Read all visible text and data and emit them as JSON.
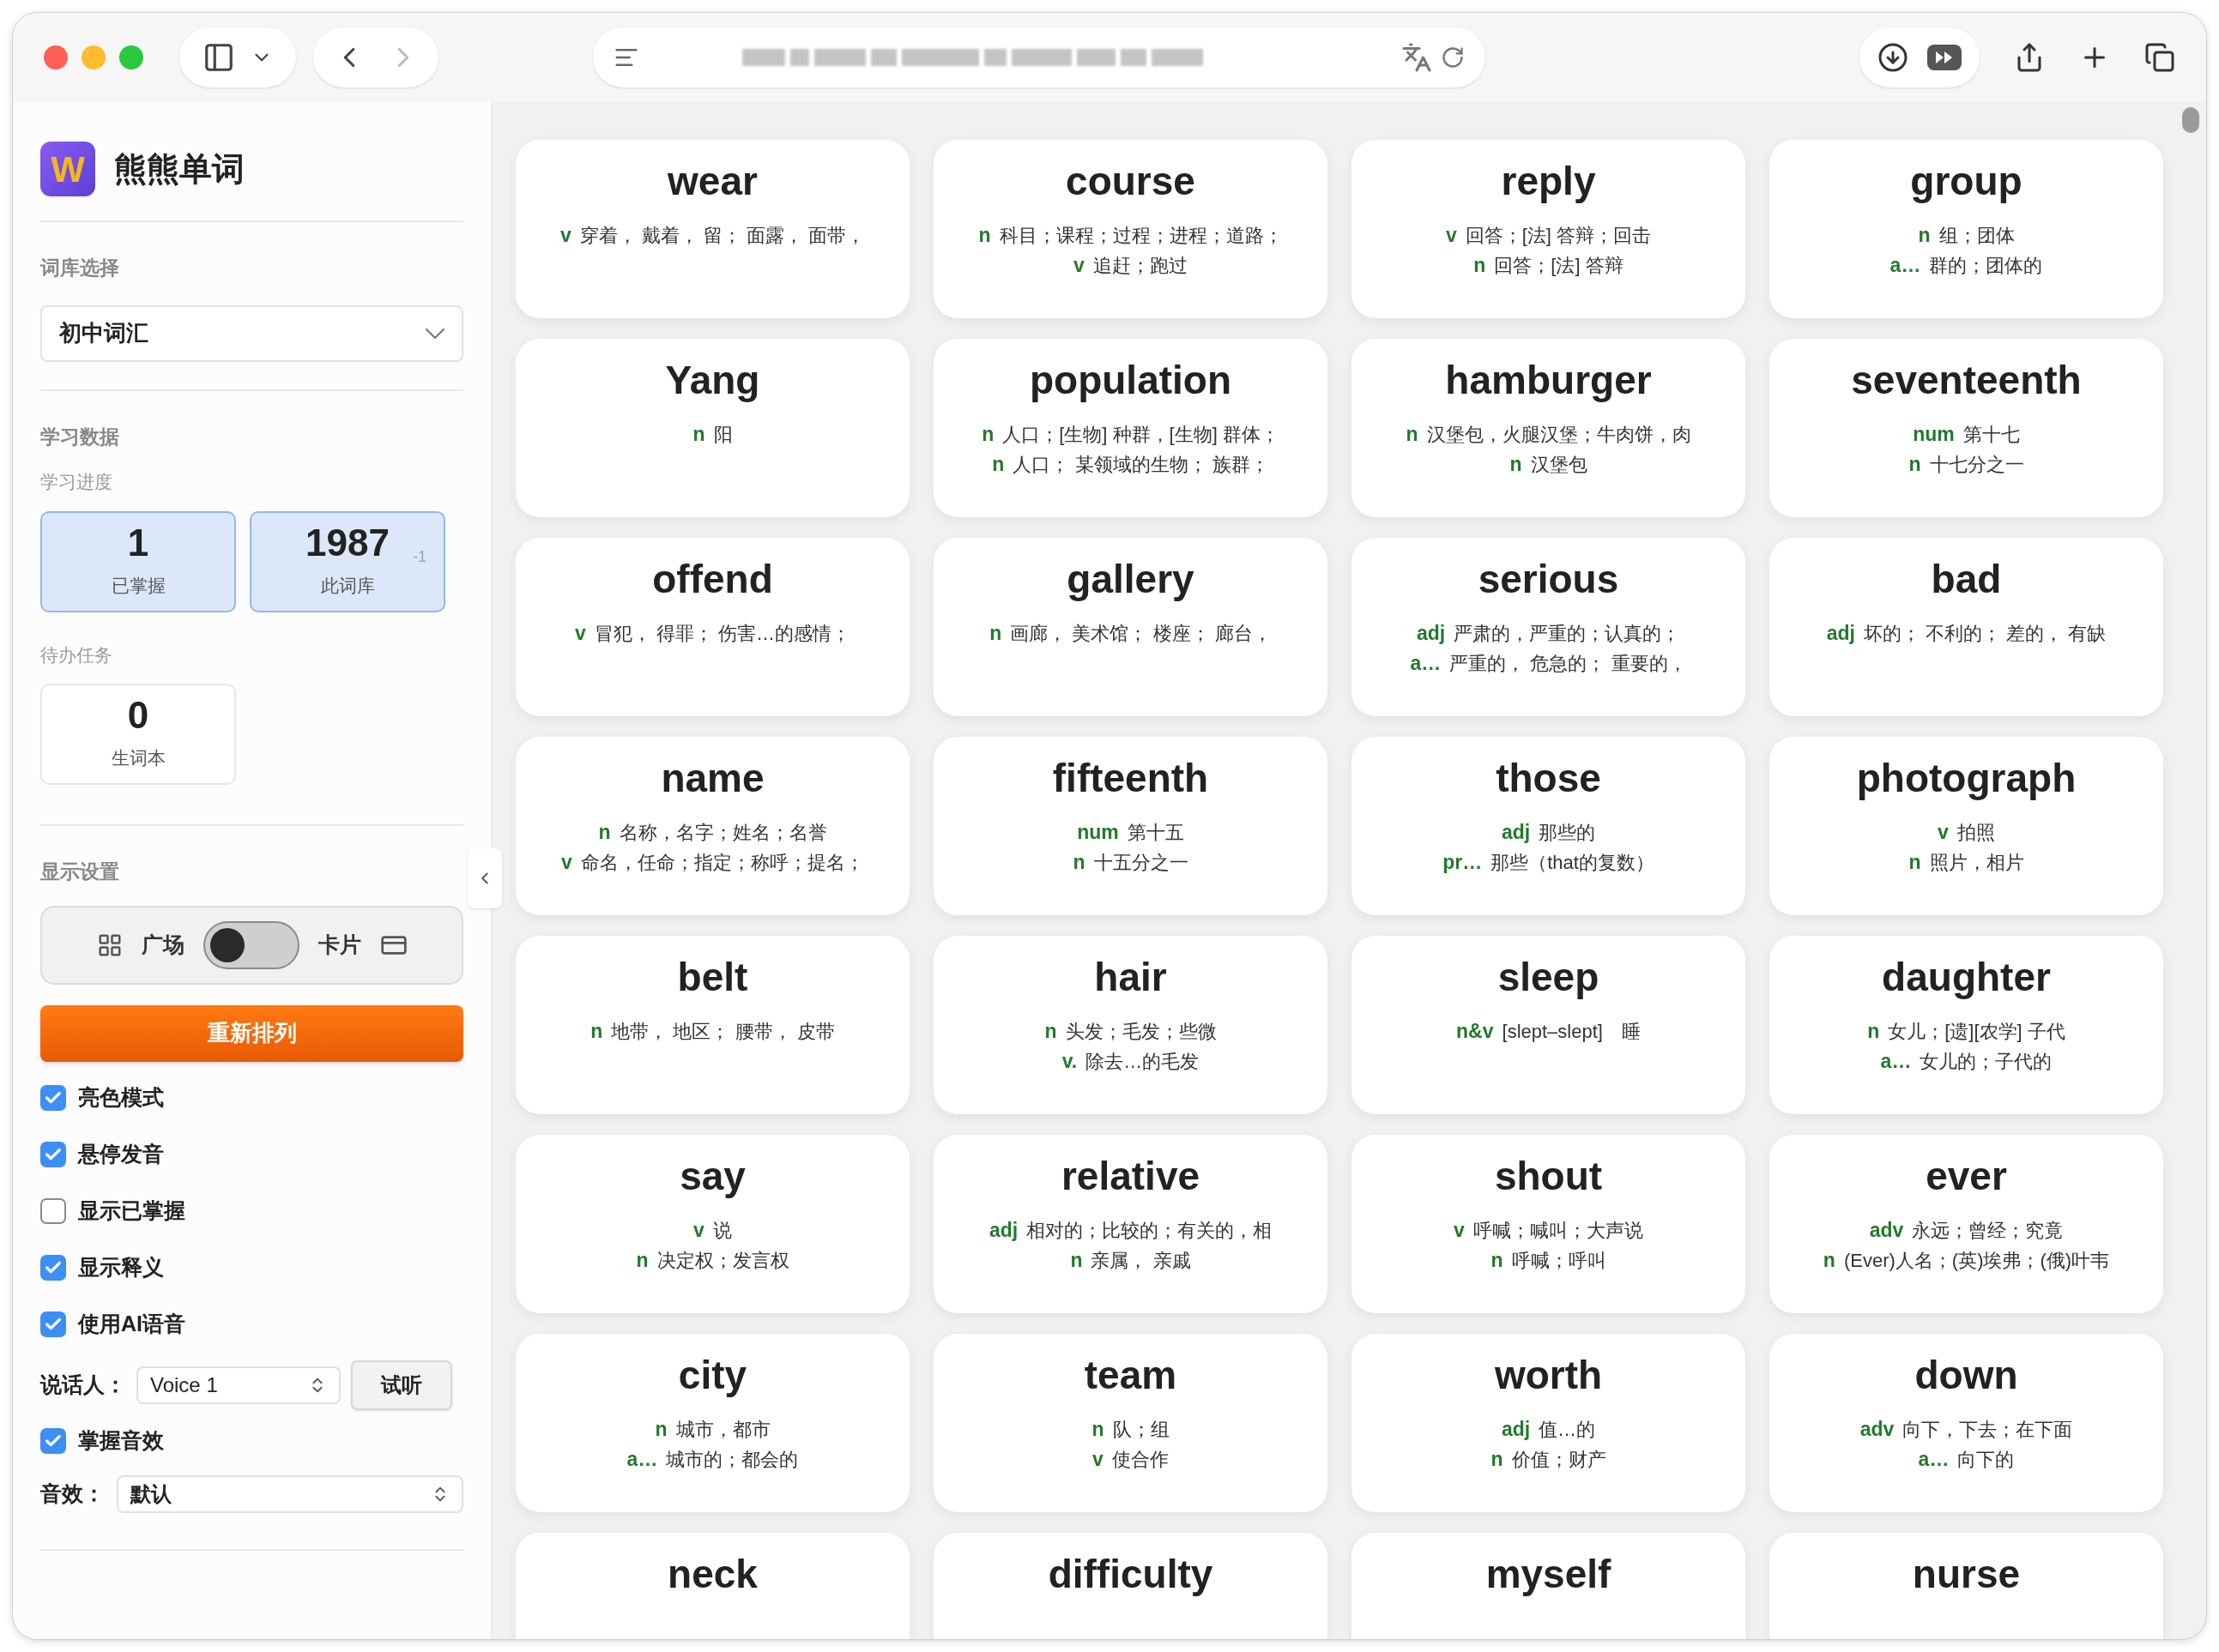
{
  "app": {
    "logo_letter": "W",
    "title": "熊熊单词"
  },
  "sidebar": {
    "library_label": "词库选择",
    "library_select": {
      "value": "初中词汇"
    },
    "stats_label": "学习数据",
    "progress_label": "学习进度",
    "progress": [
      {
        "value": "1",
        "label": "已掌握"
      },
      {
        "value": "1987",
        "label": "此词库",
        "delta": "-1"
      }
    ],
    "todo_label": "待办任务",
    "todo": [
      {
        "value": "0",
        "label": "生词本"
      }
    ],
    "display_label": "显示设置",
    "view_toggle": {
      "left": "广场",
      "right": "卡片",
      "on": false
    },
    "shuffle_button": "重新排列",
    "options": [
      {
        "label": "亮色模式",
        "checked": true
      },
      {
        "label": "悬停发音",
        "checked": true
      },
      {
        "label": "显示已掌握",
        "checked": false
      },
      {
        "label": "显示释义",
        "checked": true
      },
      {
        "label": "使用AI语音",
        "checked": true
      }
    ],
    "speaker": {
      "label": "说话人：",
      "value": "Voice 1",
      "button": "试听"
    },
    "sound_option": {
      "label": "掌握音效",
      "checked": true
    },
    "sound": {
      "label": "音效：",
      "value": "默认"
    }
  },
  "cards": [
    {
      "word": "wear",
      "senses": [
        {
          "pos": "v",
          "text": "穿着， 戴着， 留； 面露， 面带，"
        }
      ]
    },
    {
      "word": "course",
      "senses": [
        {
          "pos": "n",
          "text": "科目；课程；过程；进程；道路；"
        },
        {
          "pos": "v",
          "text": "追赶；跑过"
        }
      ]
    },
    {
      "word": "reply",
      "senses": [
        {
          "pos": "v",
          "text": "回答；[法] 答辩；回击"
        },
        {
          "pos": "n",
          "text": "回答；[法] 答辩"
        }
      ]
    },
    {
      "word": "group",
      "senses": [
        {
          "pos": "n",
          "text": "组；团体"
        },
        {
          "pos": "a…",
          "text": "群的；团体的"
        }
      ]
    },
    {
      "word": "Yang",
      "senses": [
        {
          "pos": "n",
          "text": "阳"
        }
      ]
    },
    {
      "word": "population",
      "senses": [
        {
          "pos": "n",
          "text": "人口；[生物] 种群，[生物] 群体；"
        },
        {
          "pos": "n",
          "text": "人口； 某领域的生物； 族群；"
        }
      ]
    },
    {
      "word": "hamburger",
      "senses": [
        {
          "pos": "n",
          "text": "汉堡包，火腿汉堡；牛肉饼，肉"
        },
        {
          "pos": "n",
          "text": "汉堡包"
        }
      ]
    },
    {
      "word": "seventeenth",
      "senses": [
        {
          "pos": "num",
          "text": "第十七"
        },
        {
          "pos": "n",
          "text": "十七分之一"
        }
      ]
    },
    {
      "word": "offend",
      "senses": [
        {
          "pos": "v",
          "text": "冒犯， 得罪； 伤害…的感情；"
        }
      ]
    },
    {
      "word": "gallery",
      "senses": [
        {
          "pos": "n",
          "text": "画廊， 美术馆； 楼座； 廊台，"
        }
      ]
    },
    {
      "word": "serious",
      "senses": [
        {
          "pos": "adj",
          "text": "严肃的，严重的；认真的；"
        },
        {
          "pos": "a…",
          "text": "严重的， 危急的； 重要的，"
        }
      ]
    },
    {
      "word": "bad",
      "senses": [
        {
          "pos": "adj",
          "text": "坏的； 不利的； 差的， 有缺"
        }
      ]
    },
    {
      "word": "name",
      "senses": [
        {
          "pos": "n",
          "text": "名称，名字；姓名；名誉"
        },
        {
          "pos": "v",
          "text": "命名，任命；指定；称呼；提名；"
        }
      ]
    },
    {
      "word": "fifteenth",
      "senses": [
        {
          "pos": "num",
          "text": "第十五"
        },
        {
          "pos": "n",
          "text": "十五分之一"
        }
      ]
    },
    {
      "word": "those",
      "senses": [
        {
          "pos": "adj",
          "text": "那些的"
        },
        {
          "pos": "pr…",
          "text": "那些（that的复数）"
        }
      ]
    },
    {
      "word": "photograph",
      "senses": [
        {
          "pos": "v",
          "text": "拍照"
        },
        {
          "pos": "n",
          "text": "照片，相片"
        }
      ]
    },
    {
      "word": "belt",
      "senses": [
        {
          "pos": "n",
          "text": "地带， 地区； 腰带， 皮带"
        }
      ]
    },
    {
      "word": "hair",
      "senses": [
        {
          "pos": "n",
          "text": "头发；毛发；些微"
        },
        {
          "pos": "v.",
          "text": "除去…的毛发"
        }
      ]
    },
    {
      "word": "sleep",
      "senses": [
        {
          "pos": "n&v",
          "text": "[slept–slept]　睡"
        }
      ]
    },
    {
      "word": "daughter",
      "senses": [
        {
          "pos": "n",
          "text": "女儿；[遗][农学] 子代"
        },
        {
          "pos": "a…",
          "text": "女儿的；子代的"
        }
      ]
    },
    {
      "word": "say",
      "senses": [
        {
          "pos": "v",
          "text": "说"
        },
        {
          "pos": "n",
          "text": "决定权；发言权"
        }
      ]
    },
    {
      "word": "relative",
      "senses": [
        {
          "pos": "adj",
          "text": "相对的；比较的；有关的，相"
        },
        {
          "pos": "n",
          "text": "亲属， 亲戚"
        }
      ]
    },
    {
      "word": "shout",
      "senses": [
        {
          "pos": "v",
          "text": "呼喊；喊叫；大声说"
        },
        {
          "pos": "n",
          "text": "呼喊；呼叫"
        }
      ]
    },
    {
      "word": "ever",
      "senses": [
        {
          "pos": "adv",
          "text": "永远；曾经；究竟"
        },
        {
          "pos": "n",
          "text": "(Ever)人名；(英)埃弗；(俄)叶韦"
        }
      ]
    },
    {
      "word": "city",
      "senses": [
        {
          "pos": "n",
          "text": "城市，都市"
        },
        {
          "pos": "a…",
          "text": "城市的；都会的"
        }
      ]
    },
    {
      "word": "team",
      "senses": [
        {
          "pos": "n",
          "text": "队；组"
        },
        {
          "pos": "v",
          "text": "使合作"
        }
      ]
    },
    {
      "word": "worth",
      "senses": [
        {
          "pos": "adj",
          "text": "值…的"
        },
        {
          "pos": "n",
          "text": "价值；财产"
        }
      ]
    },
    {
      "word": "down",
      "senses": [
        {
          "pos": "adv",
          "text": "向下，下去；在下面"
        },
        {
          "pos": "a…",
          "text": "向下的"
        }
      ]
    },
    {
      "word": "neck"
    },
    {
      "word": "difficulty"
    },
    {
      "word": "myself"
    },
    {
      "word": "nurse"
    }
  ]
}
